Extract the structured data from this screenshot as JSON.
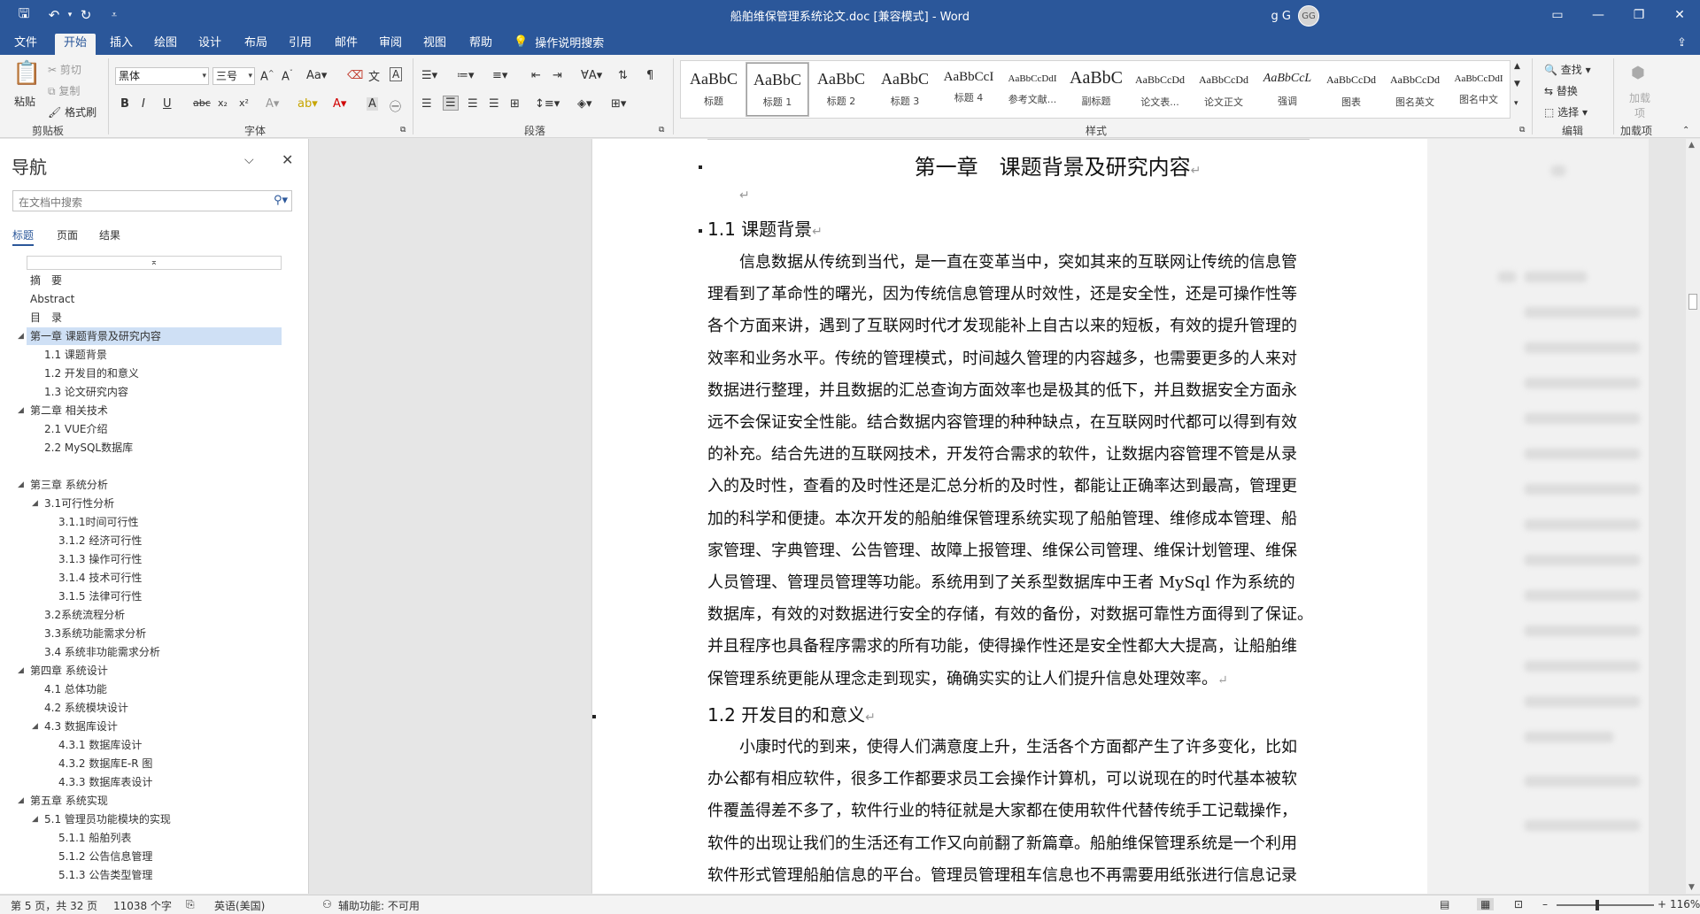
{
  "titlebar": {
    "title": "船舶维保管理系统论文.doc [兼容模式]  -  Word",
    "user_name": "g G",
    "user_initials": "GG"
  },
  "menu": {
    "tabs": [
      "文件",
      "开始",
      "插入",
      "绘图",
      "设计",
      "布局",
      "引用",
      "邮件",
      "审阅",
      "视图",
      "帮助"
    ],
    "active": "开始",
    "tell_me": "操作说明搜索"
  },
  "ribbon": {
    "clipboard": {
      "paste": "粘贴",
      "cut": "剪切",
      "copy": "复制",
      "format_painter": "格式刷",
      "label": "剪贴板"
    },
    "font": {
      "font_name": "黑体",
      "font_size": "三号",
      "label": "字体"
    },
    "paragraph": {
      "label": "段落"
    },
    "styles": {
      "label": "样式",
      "items": [
        {
          "preview": "AaBbC",
          "name": "标题"
        },
        {
          "preview": "AaBbC",
          "name": "标题 1"
        },
        {
          "preview": "AaBbC",
          "name": "标题 2"
        },
        {
          "preview": "AaBbC",
          "name": "标题 3"
        },
        {
          "preview": "AaBbCcI",
          "name": "标题 4"
        },
        {
          "preview": "AaBbCcDdI",
          "name": "参考文献..."
        },
        {
          "preview": "AaBbC",
          "name": "副标题"
        },
        {
          "preview": "AaBbCcDd",
          "name": "论文表..."
        },
        {
          "preview": "AaBbCcDd",
          "name": "论文正文"
        },
        {
          "preview": "AaBbCcL",
          "name": "强调"
        },
        {
          "preview": "AaBbCcDd",
          "name": "图表"
        },
        {
          "preview": "AaBbCcDd",
          "name": "图名英文"
        },
        {
          "preview": "AaBbCcDdI",
          "name": "图名中文"
        }
      ],
      "selected_index": 1
    },
    "editing": {
      "find": "查找",
      "replace": "替换",
      "select": "选择",
      "label": "编辑"
    },
    "addins": {
      "button": "加载项",
      "label": "加载项"
    }
  },
  "nav": {
    "title": "导航",
    "search_placeholder": "在文档中搜索",
    "tabs": [
      "标题",
      "页面",
      "结果"
    ],
    "active_tab": "标题",
    "headings": [
      {
        "text": "摘　要",
        "level": 1,
        "collapse": false
      },
      {
        "text": "Abstract",
        "level": 1,
        "collapse": false
      },
      {
        "text": "目　录",
        "level": 1,
        "collapse": false
      },
      {
        "text": "第一章  课题背景及研究内容",
        "level": 1,
        "collapse": true,
        "selected": true
      },
      {
        "text": "1.1 课题背景",
        "level": 2,
        "collapse": false
      },
      {
        "text": "1.2 开发目的和意义",
        "level": 2,
        "collapse": false
      },
      {
        "text": "1.3 论文研究内容",
        "level": 2,
        "collapse": false
      },
      {
        "text": "第二章 相关技术",
        "level": 1,
        "collapse": true
      },
      {
        "text": "2.1 VUE介绍",
        "level": 2,
        "collapse": false
      },
      {
        "text": "2.2 MySQL数据库",
        "level": 2,
        "collapse": false
      },
      {
        "text": "",
        "level": 1,
        "collapse": false
      },
      {
        "text": "第三章 系统分析",
        "level": 1,
        "collapse": true
      },
      {
        "text": "3.1可行性分析",
        "level": 2,
        "collapse": true
      },
      {
        "text": "3.1.1时间可行性",
        "level": 3,
        "collapse": false
      },
      {
        "text": "3.1.2 经济可行性",
        "level": 3,
        "collapse": false
      },
      {
        "text": "3.1.3 操作可行性",
        "level": 3,
        "collapse": false
      },
      {
        "text": "3.1.4 技术可行性",
        "level": 3,
        "collapse": false
      },
      {
        "text": "3.1.5 法律可行性",
        "level": 3,
        "collapse": false
      },
      {
        "text": "3.2系统流程分析",
        "level": 2,
        "collapse": false
      },
      {
        "text": "3.3系统功能需求分析",
        "level": 2,
        "collapse": false
      },
      {
        "text": "3.4 系统非功能需求分析",
        "level": 2,
        "collapse": false
      },
      {
        "text": "第四章 系统设计",
        "level": 1,
        "collapse": true
      },
      {
        "text": "4.1 总体功能",
        "level": 2,
        "collapse": false
      },
      {
        "text": "4.2 系统模块设计",
        "level": 2,
        "collapse": false
      },
      {
        "text": "4.3 数据库设计",
        "level": 2,
        "collapse": true
      },
      {
        "text": "4.3.1 数据库设计",
        "level": 3,
        "collapse": false
      },
      {
        "text": "4.3.2 数据库E-R 图",
        "level": 3,
        "collapse": false
      },
      {
        "text": "4.3.3 数据库表设计",
        "level": 3,
        "collapse": false
      },
      {
        "text": "第五章 系统实现",
        "level": 1,
        "collapse": true
      },
      {
        "text": "5.1 管理员功能模块的实现",
        "level": 2,
        "collapse": true
      },
      {
        "text": "5.1.1 船舶列表",
        "level": 3,
        "collapse": false
      },
      {
        "text": "5.1.2 公告信息管理",
        "level": 3,
        "collapse": false
      },
      {
        "text": "5.1.3 公告类型管理",
        "level": 3,
        "collapse": false
      }
    ]
  },
  "document": {
    "chapter_title": "第一章　课题背景及研究内容",
    "section1_title": "1.1  课题背景",
    "section1_lines": [
      "　　信息数据从传统到当代，是一直在变革当中，突如其来的互联网让传统的信息管",
      "理看到了革命性的曙光，因为传统信息管理从时效性，还是安全性，还是可操作性等",
      "各个方面来讲，遇到了互联网时代才发现能补上自古以来的短板，有效的提升管理的",
      "效率和业务水平。传统的管理模式，时间越久管理的内容越多，也需要更多的人来对",
      "数据进行整理，并且数据的汇总查询方面效率也是极其的低下，并且数据安全方面永",
      "远不会保证安全性能。结合数据内容管理的种种缺点，在互联网时代都可以得到有效",
      "的补充。结合先进的互联网技术，开发符合需求的软件，让数据内容管理不管是从录",
      "入的及时性，查看的及时性还是汇总分析的及时性，都能让正确率达到最高，管理更",
      "加的科学和便捷。本次开发的船舶维保管理系统实现了船舶管理、维修成本管理、船",
      "家管理、字典管理、公告管理、故障上报管理、维保公司管理、维保计划管理、维保",
      "人员管理、管理员管理等功能。系统用到了关系型数据库中王者 MySql 作为系统的",
      "数据库，有效的对数据进行安全的存储，有效的备份，对数据可靠性方面得到了保证。",
      "并且程序也具备程序需求的所有功能，使得操作性还是安全性都大大提高，让船舶维",
      "保管理系统更能从理念走到现实，确确实实的让人们提升信息处理效率。"
    ],
    "section2_title": "1.2  开发目的和意义",
    "section2_lines": [
      "　　小康时代的到来，使得人们满意度上升，生活各个方面都产生了许多变化，比如",
      "办公都有相应软件，很多工作都要求员工会操作计算机，可以说现在的时代基本被软",
      "件覆盖得差不多了，软件行业的特征就是大家都在使用软件代替传统手工记载操作，",
      "软件的出现让我们的生活还有工作又向前翻了新篇章。船舶维保管理系统是一个利用",
      "软件形式管理船舶信息的平台。管理员管理租车信息也不再需要用纸张进行信息记录"
    ],
    "paragraph_mark": "↵"
  },
  "status": {
    "page": "第 5 页，共 32 页",
    "words": "11038 个字",
    "language": "英语(美国)",
    "accessibility": "辅助功能: 不可用",
    "zoom": "116%"
  },
  "colors": {
    "word_blue": "#2b579a",
    "ribbon_bg": "#f3f3f3",
    "nav_selected": "#cfe0f5"
  }
}
